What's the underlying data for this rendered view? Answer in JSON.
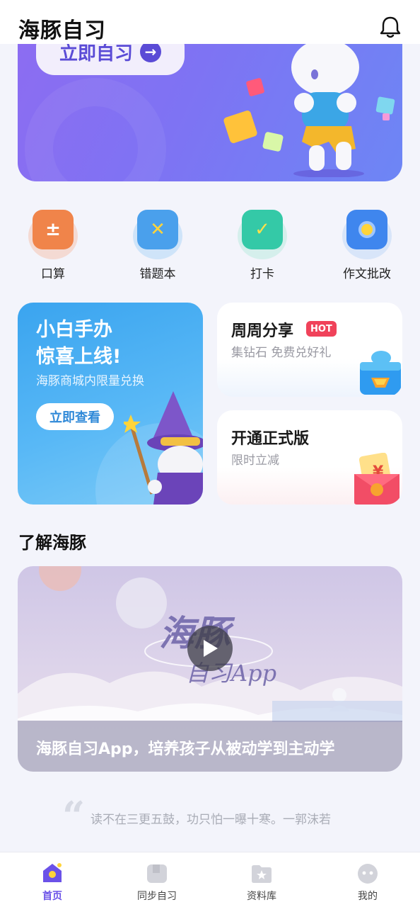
{
  "header": {
    "title": "海豚自习",
    "bell_icon": "bell-icon"
  },
  "hero": {
    "button_label": "立即自习",
    "button_icon": "arrow-right-icon"
  },
  "quick_actions": [
    {
      "label": "口算",
      "icon": "calculator-icon",
      "color": "#f0844a"
    },
    {
      "label": "错题本",
      "icon": "wrong-book-icon",
      "color": "#4aa0ec"
    },
    {
      "label": "打卡",
      "icon": "checkin-calendar-icon",
      "color": "#34c9a7"
    },
    {
      "label": "作文批改",
      "icon": "camera-icon",
      "color": "#3f86ee"
    }
  ],
  "promo_left": {
    "title_line1": "小白手办",
    "title_line2": "惊喜上线!",
    "subtitle": "海豚商城内限量兑换",
    "button_label": "立即查看"
  },
  "promo_right": [
    {
      "title": "周周分享",
      "badge": "HOT",
      "subtitle": "集钻石 免费兑好礼"
    },
    {
      "title": "开通正式版",
      "subtitle": "限时立减"
    }
  ],
  "about": {
    "section_title": "了解海豚",
    "video_caption": "海豚自习App，培养孩子从被动学到主动学"
  },
  "quote": {
    "text": "读不在三更五鼓，功只怕一曝十寒。一郭沫若"
  },
  "bottom_nav": [
    {
      "label": "首页",
      "active": true
    },
    {
      "label": "同步自习",
      "active": false
    },
    {
      "label": "资料库",
      "active": false
    },
    {
      "label": "我的",
      "active": false
    }
  ],
  "colors": {
    "accent": "#6b52e8",
    "hero_start": "#8d6cf2",
    "hero_end": "#6d86f5",
    "hot": "#f0425a"
  }
}
